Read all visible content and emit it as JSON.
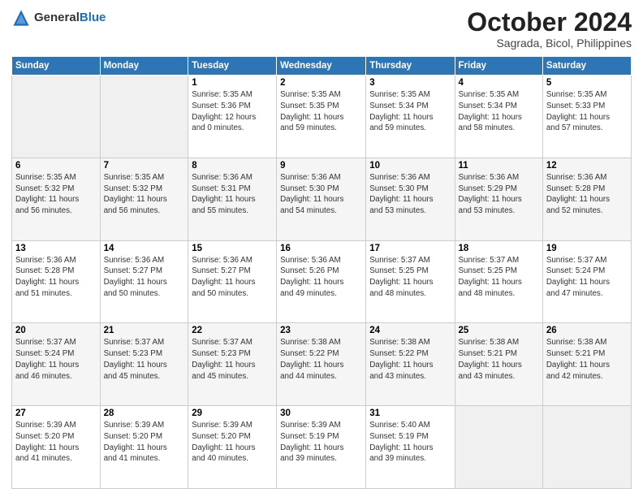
{
  "header": {
    "logo_general": "General",
    "logo_blue": "Blue",
    "month_title": "October 2024",
    "subtitle": "Sagrada, Bicol, Philippines"
  },
  "weekdays": [
    "Sunday",
    "Monday",
    "Tuesday",
    "Wednesday",
    "Thursday",
    "Friday",
    "Saturday"
  ],
  "weeks": [
    [
      {
        "day": "",
        "info": ""
      },
      {
        "day": "",
        "info": ""
      },
      {
        "day": "1",
        "info": "Sunrise: 5:35 AM\nSunset: 5:36 PM\nDaylight: 12 hours\nand 0 minutes."
      },
      {
        "day": "2",
        "info": "Sunrise: 5:35 AM\nSunset: 5:35 PM\nDaylight: 11 hours\nand 59 minutes."
      },
      {
        "day": "3",
        "info": "Sunrise: 5:35 AM\nSunset: 5:34 PM\nDaylight: 11 hours\nand 59 minutes."
      },
      {
        "day": "4",
        "info": "Sunrise: 5:35 AM\nSunset: 5:34 PM\nDaylight: 11 hours\nand 58 minutes."
      },
      {
        "day": "5",
        "info": "Sunrise: 5:35 AM\nSunset: 5:33 PM\nDaylight: 11 hours\nand 57 minutes."
      }
    ],
    [
      {
        "day": "6",
        "info": "Sunrise: 5:35 AM\nSunset: 5:32 PM\nDaylight: 11 hours\nand 56 minutes."
      },
      {
        "day": "7",
        "info": "Sunrise: 5:35 AM\nSunset: 5:32 PM\nDaylight: 11 hours\nand 56 minutes."
      },
      {
        "day": "8",
        "info": "Sunrise: 5:36 AM\nSunset: 5:31 PM\nDaylight: 11 hours\nand 55 minutes."
      },
      {
        "day": "9",
        "info": "Sunrise: 5:36 AM\nSunset: 5:30 PM\nDaylight: 11 hours\nand 54 minutes."
      },
      {
        "day": "10",
        "info": "Sunrise: 5:36 AM\nSunset: 5:30 PM\nDaylight: 11 hours\nand 53 minutes."
      },
      {
        "day": "11",
        "info": "Sunrise: 5:36 AM\nSunset: 5:29 PM\nDaylight: 11 hours\nand 53 minutes."
      },
      {
        "day": "12",
        "info": "Sunrise: 5:36 AM\nSunset: 5:28 PM\nDaylight: 11 hours\nand 52 minutes."
      }
    ],
    [
      {
        "day": "13",
        "info": "Sunrise: 5:36 AM\nSunset: 5:28 PM\nDaylight: 11 hours\nand 51 minutes."
      },
      {
        "day": "14",
        "info": "Sunrise: 5:36 AM\nSunset: 5:27 PM\nDaylight: 11 hours\nand 50 minutes."
      },
      {
        "day": "15",
        "info": "Sunrise: 5:36 AM\nSunset: 5:27 PM\nDaylight: 11 hours\nand 50 minutes."
      },
      {
        "day": "16",
        "info": "Sunrise: 5:36 AM\nSunset: 5:26 PM\nDaylight: 11 hours\nand 49 minutes."
      },
      {
        "day": "17",
        "info": "Sunrise: 5:37 AM\nSunset: 5:25 PM\nDaylight: 11 hours\nand 48 minutes."
      },
      {
        "day": "18",
        "info": "Sunrise: 5:37 AM\nSunset: 5:25 PM\nDaylight: 11 hours\nand 48 minutes."
      },
      {
        "day": "19",
        "info": "Sunrise: 5:37 AM\nSunset: 5:24 PM\nDaylight: 11 hours\nand 47 minutes."
      }
    ],
    [
      {
        "day": "20",
        "info": "Sunrise: 5:37 AM\nSunset: 5:24 PM\nDaylight: 11 hours\nand 46 minutes."
      },
      {
        "day": "21",
        "info": "Sunrise: 5:37 AM\nSunset: 5:23 PM\nDaylight: 11 hours\nand 45 minutes."
      },
      {
        "day": "22",
        "info": "Sunrise: 5:37 AM\nSunset: 5:23 PM\nDaylight: 11 hours\nand 45 minutes."
      },
      {
        "day": "23",
        "info": "Sunrise: 5:38 AM\nSunset: 5:22 PM\nDaylight: 11 hours\nand 44 minutes."
      },
      {
        "day": "24",
        "info": "Sunrise: 5:38 AM\nSunset: 5:22 PM\nDaylight: 11 hours\nand 43 minutes."
      },
      {
        "day": "25",
        "info": "Sunrise: 5:38 AM\nSunset: 5:21 PM\nDaylight: 11 hours\nand 43 minutes."
      },
      {
        "day": "26",
        "info": "Sunrise: 5:38 AM\nSunset: 5:21 PM\nDaylight: 11 hours\nand 42 minutes."
      }
    ],
    [
      {
        "day": "27",
        "info": "Sunrise: 5:39 AM\nSunset: 5:20 PM\nDaylight: 11 hours\nand 41 minutes."
      },
      {
        "day": "28",
        "info": "Sunrise: 5:39 AM\nSunset: 5:20 PM\nDaylight: 11 hours\nand 41 minutes."
      },
      {
        "day": "29",
        "info": "Sunrise: 5:39 AM\nSunset: 5:20 PM\nDaylight: 11 hours\nand 40 minutes."
      },
      {
        "day": "30",
        "info": "Sunrise: 5:39 AM\nSunset: 5:19 PM\nDaylight: 11 hours\nand 39 minutes."
      },
      {
        "day": "31",
        "info": "Sunrise: 5:40 AM\nSunset: 5:19 PM\nDaylight: 11 hours\nand 39 minutes."
      },
      {
        "day": "",
        "info": ""
      },
      {
        "day": "",
        "info": ""
      }
    ]
  ]
}
